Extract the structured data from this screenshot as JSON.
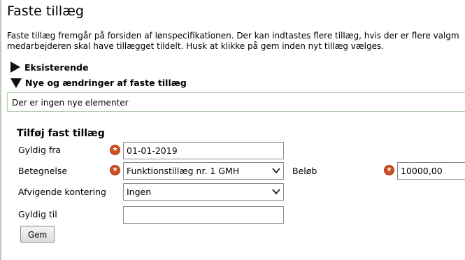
{
  "page": {
    "title": "Faste tillæg",
    "intro_line1": "Faste tillæg fremgår på forsiden af lønspecifikationen. Der kan indtastes flere tillæg, hvis der er flere valgm",
    "intro_line2": "medarbejderen skal have tillægget tildelt. Husk at klikke på gem inden nyt tillæg vælges."
  },
  "sections": {
    "existing": {
      "label": "Eksisterende",
      "state": "collapsed"
    },
    "new_changes": {
      "label": "Nye og ændringer af faste tillæg",
      "state": "expanded",
      "empty_text": "Der er ingen nye elementer"
    }
  },
  "form": {
    "title": "Tilføj fast tillæg",
    "gyldig_fra": {
      "label": "Gyldig fra",
      "value": "01-01-2019",
      "required": true
    },
    "betegnelse": {
      "label": "Betegnelse",
      "value": "Funktionstillæg nr. 1 GMH",
      "required": true
    },
    "beloeb": {
      "label": "Beløb",
      "value": "10000,00",
      "required": true
    },
    "afvigende": {
      "label": "Afvigende kontering",
      "value": "Ingen"
    },
    "gyldig_til": {
      "label": "Gyldig til",
      "value": ""
    },
    "save_label": "Gem"
  },
  "icons": {
    "required": "star-icon",
    "dropdown": "chevron-down-icon",
    "collapsed": "triangle-right-icon",
    "expanded": "triangle-down-icon"
  },
  "colors": {
    "required_badge": "#cf4f22",
    "box_border": "#b7cdb1"
  }
}
